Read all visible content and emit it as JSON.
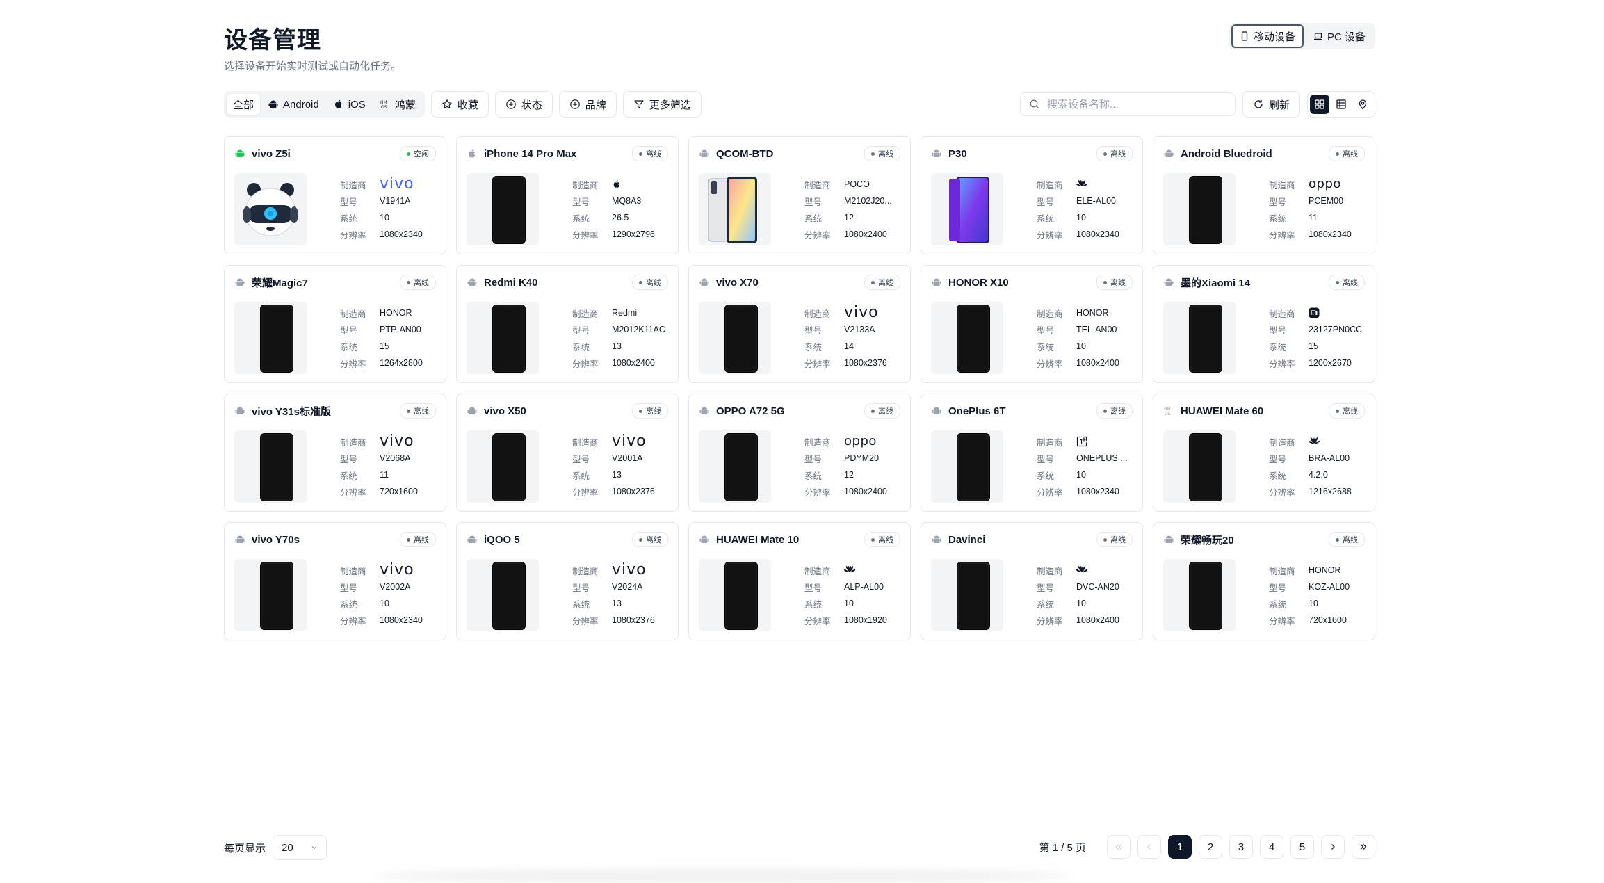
{
  "header": {
    "title": "设备管理",
    "subtitle": "选择设备开始实时测试或自动化任务。",
    "modes": [
      "移动设备",
      "PC 设备"
    ],
    "active_mode": 0
  },
  "filters": {
    "os_options": [
      "全部",
      "Android",
      "iOS",
      "鸿蒙"
    ],
    "buttons": [
      "收藏",
      "状态",
      "品牌",
      "更多筛选"
    ]
  },
  "toolbar": {
    "search_placeholder": "搜索设备名称...",
    "refresh_label": "刷新",
    "views": [
      "grid-view-icon",
      "table-view-icon",
      "map-pin-icon"
    ]
  },
  "spec_labels": [
    "制造商",
    "型号",
    "系统",
    "分辨率"
  ],
  "devices": [
    {
      "os": "android-green",
      "name": "vivo Z5i",
      "status": "空闲",
      "status_kind": "idle",
      "thumb": "panda",
      "brand": "vivo",
      "brand_logo": "vivo",
      "model": "V1941A",
      "system": "10",
      "resolution": "1080x2340"
    },
    {
      "os": "apple",
      "name": "iPhone 14 Pro Max",
      "status": "离线",
      "status_kind": "offline",
      "thumb": "phone",
      "brand": "Apple",
      "brand_logo": "apple",
      "model": "MQ8A3",
      "system": "26.5",
      "resolution": "1290x2796"
    },
    {
      "os": "android",
      "name": "QCOM-BTD",
      "status": "离线",
      "status_kind": "offline",
      "thumb": "phone-color",
      "brand": "POCO",
      "brand_logo": "text",
      "model": "M2102J20...",
      "system": "12",
      "resolution": "1080x2400"
    },
    {
      "os": "android",
      "name": "P30",
      "status": "离线",
      "status_kind": "offline",
      "thumb": "phone-purple",
      "brand": "HUAWEI",
      "brand_logo": "huawei",
      "model": "ELE-AL00",
      "system": "10",
      "resolution": "1080x2340"
    },
    {
      "os": "android",
      "name": "Android Bluedroid",
      "status": "离线",
      "status_kind": "offline",
      "thumb": "phone",
      "brand": "OPPO",
      "brand_logo": "oppo",
      "model": "PCEM00",
      "system": "11",
      "resolution": "1080x2340"
    },
    {
      "os": "android",
      "name": "荣耀Magic7",
      "status": "离线",
      "status_kind": "offline",
      "thumb": "phone",
      "brand": "HONOR",
      "brand_logo": "text",
      "model": "PTP-AN00",
      "system": "15",
      "resolution": "1264x2800"
    },
    {
      "os": "android",
      "name": "Redmi K40",
      "status": "离线",
      "status_kind": "offline",
      "thumb": "phone",
      "brand": "Redmi",
      "brand_logo": "text",
      "model": "M2012K11AC",
      "system": "13",
      "resolution": "1080x2400"
    },
    {
      "os": "android",
      "name": "vivo X70",
      "status": "离线",
      "status_kind": "offline",
      "thumb": "phone",
      "brand": "vivo",
      "brand_logo": "vivo",
      "model": "V2133A",
      "system": "14",
      "resolution": "1080x2376"
    },
    {
      "os": "android",
      "name": "HONOR X10",
      "status": "离线",
      "status_kind": "offline",
      "thumb": "phone",
      "brand": "HONOR",
      "brand_logo": "text",
      "model": "TEL-AN00",
      "system": "10",
      "resolution": "1080x2400"
    },
    {
      "os": "android",
      "name": "墨的Xiaomi 14",
      "status": "离线",
      "status_kind": "offline",
      "thumb": "phone",
      "brand": "Xiaomi",
      "brand_logo": "xiaomi",
      "model": "23127PN0CC",
      "system": "15",
      "resolution": "1200x2670"
    },
    {
      "os": "android",
      "name": "vivo Y31s标准版",
      "status": "离线",
      "status_kind": "offline",
      "thumb": "phone",
      "brand": "vivo",
      "brand_logo": "vivo",
      "model": "V2068A",
      "system": "11",
      "resolution": "720x1600"
    },
    {
      "os": "android",
      "name": "vivo X50",
      "status": "离线",
      "status_kind": "offline",
      "thumb": "phone",
      "brand": "vivo",
      "brand_logo": "vivo",
      "model": "V2001A",
      "system": "13",
      "resolution": "1080x2376"
    },
    {
      "os": "android",
      "name": "OPPO A72 5G",
      "status": "离线",
      "status_kind": "offline",
      "thumb": "phone",
      "brand": "OPPO",
      "brand_logo": "oppo",
      "model": "PDYM20",
      "system": "12",
      "resolution": "1080x2400"
    },
    {
      "os": "android",
      "name": "OnePlus 6T",
      "status": "离线",
      "status_kind": "offline",
      "thumb": "phone",
      "brand": "OnePlus",
      "brand_logo": "oneplus",
      "model": "ONEPLUS ...",
      "system": "10",
      "resolution": "1080x2340"
    },
    {
      "os": "harmony",
      "name": "HUAWEI Mate 60",
      "status": "离线",
      "status_kind": "offline",
      "thumb": "phone",
      "brand": "HUAWEI",
      "brand_logo": "huawei",
      "model": "BRA-AL00",
      "system": "4.2.0",
      "resolution": "1216x2688"
    },
    {
      "os": "android",
      "name": "vivo Y70s",
      "status": "离线",
      "status_kind": "offline",
      "thumb": "phone",
      "brand": "vivo",
      "brand_logo": "vivo",
      "model": "V2002A",
      "system": "10",
      "resolution": "1080x2340"
    },
    {
      "os": "android",
      "name": "iQOO 5",
      "status": "离线",
      "status_kind": "offline",
      "thumb": "phone",
      "brand": "vivo",
      "brand_logo": "vivo",
      "model": "V2024A",
      "system": "13",
      "resolution": "1080x2376"
    },
    {
      "os": "android",
      "name": "HUAWEI Mate 10",
      "status": "离线",
      "status_kind": "offline",
      "thumb": "phone",
      "brand": "HUAWEI",
      "brand_logo": "huawei",
      "model": "ALP-AL00",
      "system": "10",
      "resolution": "1080x1920"
    },
    {
      "os": "android",
      "name": "Davinci",
      "status": "离线",
      "status_kind": "offline",
      "thumb": "phone",
      "brand": "HUAWEI",
      "brand_logo": "huawei",
      "model": "DVC-AN20",
      "system": "10",
      "resolution": "1080x2400"
    },
    {
      "os": "android",
      "name": "荣耀畅玩20",
      "status": "离线",
      "status_kind": "offline",
      "thumb": "phone",
      "brand": "HONOR",
      "brand_logo": "text",
      "model": "KOZ-AL00",
      "system": "10",
      "resolution": "720x1600"
    }
  ],
  "pagination": {
    "per_page_label": "每页显示",
    "per_page": "20",
    "page_info": "第 1 / 5 页",
    "pages": [
      "1",
      "2",
      "3",
      "4",
      "5"
    ],
    "current": 1
  },
  "colors": {
    "accent": "#0f172a",
    "idle": "#22c55e",
    "vivo": "#415fff",
    "border": "#e5e7eb"
  }
}
